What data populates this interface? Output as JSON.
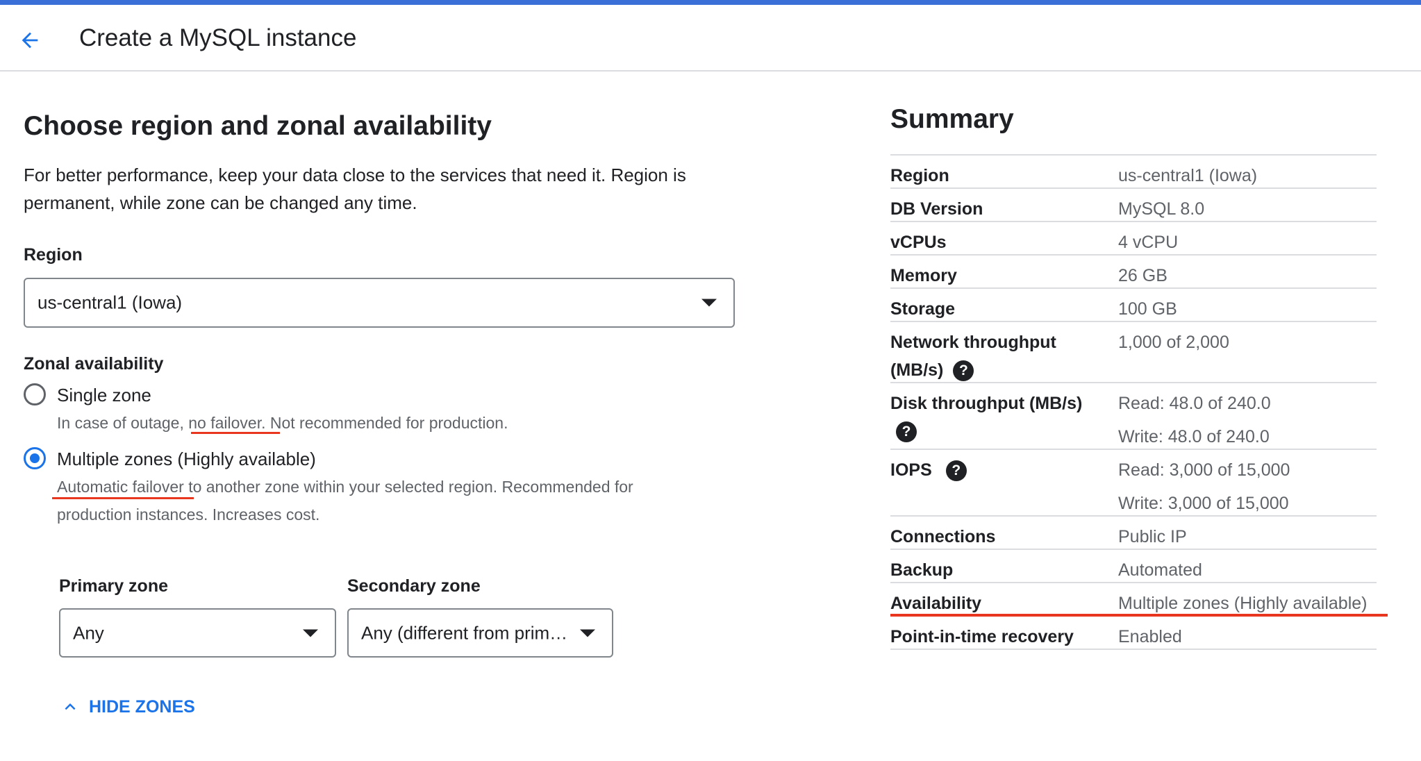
{
  "header": {
    "title": "Create a MySQL instance",
    "back_icon": "arrow-back-icon"
  },
  "colors": {
    "accent": "#1a73e8",
    "top_bar": "#3b6fd8",
    "annotation_underline": "#e8361f"
  },
  "section": {
    "title": "Choose region and zonal availability",
    "description": "For better performance, keep your data close to the services that need it. Region is permanent, while zone can be changed any time."
  },
  "region": {
    "label": "Region",
    "value": "us-central1 (Iowa)"
  },
  "zonal": {
    "label": "Zonal availability",
    "options": [
      {
        "label": "Single zone",
        "help": "In case of outage, no failover. Not recommended for production.",
        "selected": false
      },
      {
        "label": "Multiple zones (Highly available)",
        "help": "Automatic failover to another zone within your selected region. Recommended for production instances. Increases cost.",
        "selected": true
      }
    ]
  },
  "zones": {
    "primary_label": "Primary zone",
    "primary_value": "Any",
    "secondary_label": "Secondary zone",
    "secondary_value": "Any (different from primary)",
    "hide_label": "HIDE ZONES"
  },
  "summary": {
    "title": "Summary",
    "rows": [
      {
        "key": "Region",
        "values": [
          "us-central1 (Iowa)"
        ]
      },
      {
        "key": "DB Version",
        "values": [
          "MySQL 8.0"
        ]
      },
      {
        "key": "vCPUs",
        "values": [
          "4 vCPU"
        ]
      },
      {
        "key": "Memory",
        "values": [
          "26 GB"
        ]
      },
      {
        "key": "Storage",
        "values": [
          "100 GB"
        ]
      },
      {
        "key": "Network throughput (MB/s)",
        "values": [
          "1,000 of 2,000"
        ],
        "help": true
      },
      {
        "key": "Disk throughput (MB/s)",
        "values": [
          "Read: 48.0 of 240.0",
          "Write: 48.0 of 240.0"
        ],
        "help": true
      },
      {
        "key": "IOPS",
        "values": [
          "Read: 3,000 of 15,000",
          "Write: 3,000 of 15,000"
        ],
        "help": true
      },
      {
        "key": "Connections",
        "values": [
          "Public IP"
        ]
      },
      {
        "key": "Backup",
        "values": [
          "Automated"
        ]
      },
      {
        "key": "Availability",
        "values": [
          "Multiple zones (Highly available)"
        ]
      },
      {
        "key": "Point-in-time recovery",
        "values": [
          "Enabled"
        ]
      }
    ]
  }
}
